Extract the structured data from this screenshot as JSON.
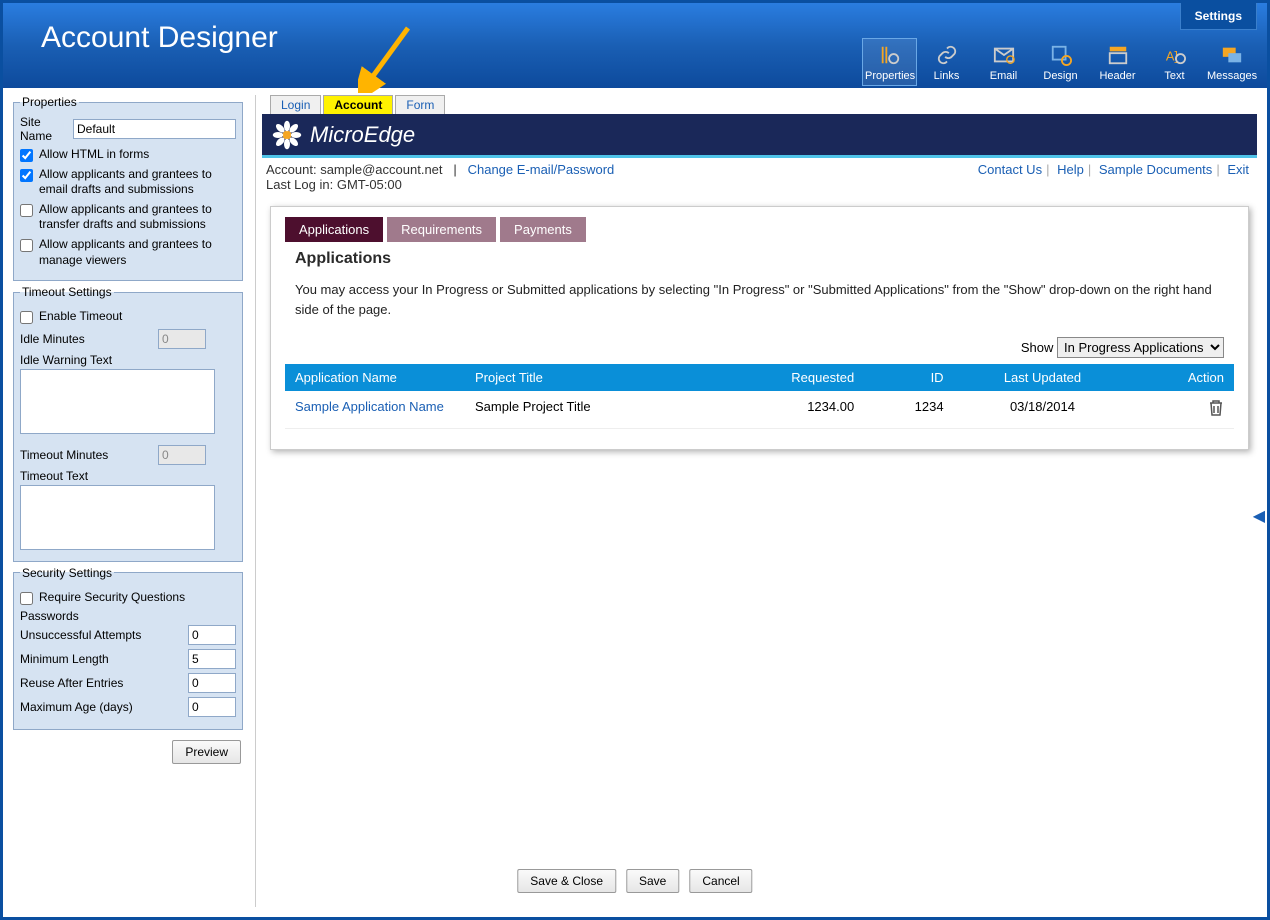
{
  "header": {
    "title": "Account Designer",
    "settings_tab": "Settings",
    "toolbar": {
      "properties": "Properties",
      "links": "Links",
      "email": "Email",
      "design": "Design",
      "headerb": "Header",
      "text": "Text",
      "messages": "Messages"
    }
  },
  "sidebar": {
    "properties_legend": "Properties",
    "site_name_label": "Site Name",
    "site_name_value": "Default",
    "cb_allow_html": "Allow HTML in forms",
    "cb_email_drafts": "Allow applicants and grantees to email drafts and submissions",
    "cb_transfer": "Allow applicants and grantees to transfer drafts and submissions",
    "cb_manage_viewers": "Allow applicants and grantees to manage viewers",
    "timeout_legend": "Timeout Settings",
    "cb_enable_timeout": "Enable Timeout",
    "idle_minutes_label": "Idle Minutes",
    "idle_minutes_value": "0",
    "idle_warning_label": "Idle Warning Text",
    "timeout_minutes_label": "Timeout Minutes",
    "timeout_minutes_value": "0",
    "timeout_text_label": "Timeout Text",
    "security_legend": "Security Settings",
    "cb_require_security": "Require Security Questions",
    "passwords_label": "Passwords",
    "unsuccessful_label": "Unsuccessful Attempts",
    "unsuccessful_value": "0",
    "min_length_label": "Minimum Length",
    "min_length_value": "5",
    "reuse_label": "Reuse After Entries",
    "reuse_value": "0",
    "max_age_label": "Maximum Age (days)",
    "max_age_value": "0",
    "preview_button": "Preview"
  },
  "preview": {
    "tabs": {
      "login": "Login",
      "account": "Account",
      "form": "Form"
    },
    "brand": "MicroEdge",
    "account_label": "Account: ",
    "account_email": "sample@account.net",
    "change_link": "Change E-mail/Password",
    "last_login": "Last Log in: GMT-05:00",
    "topnav": {
      "contact": "Contact Us",
      "help": "Help",
      "samples": "Sample Documents",
      "exit": "Exit"
    },
    "inner_tabs": {
      "applications": "Applications",
      "requirements": "Requirements",
      "payments": "Payments"
    },
    "section_title": "Applications",
    "section_desc": "You may access your In Progress or Submitted applications by selecting \"In Progress\" or \"Submitted Applications\" from the \"Show\" drop-down on the right hand side of the page.",
    "show_label": "Show",
    "show_value": "In Progress Applications",
    "columns": {
      "app_name": "Application Name",
      "project_title": "Project Title",
      "requested": "Requested",
      "id": "ID",
      "last_updated": "Last Updated",
      "action": "Action"
    },
    "rows": [
      {
        "app_name": "Sample Application Name",
        "project_title": "Sample Project Title",
        "requested": "1234.00",
        "id": "1234",
        "last_updated": "03/18/2014"
      }
    ]
  },
  "footer": {
    "save_close": "Save & Close",
    "save": "Save",
    "cancel": "Cancel"
  }
}
